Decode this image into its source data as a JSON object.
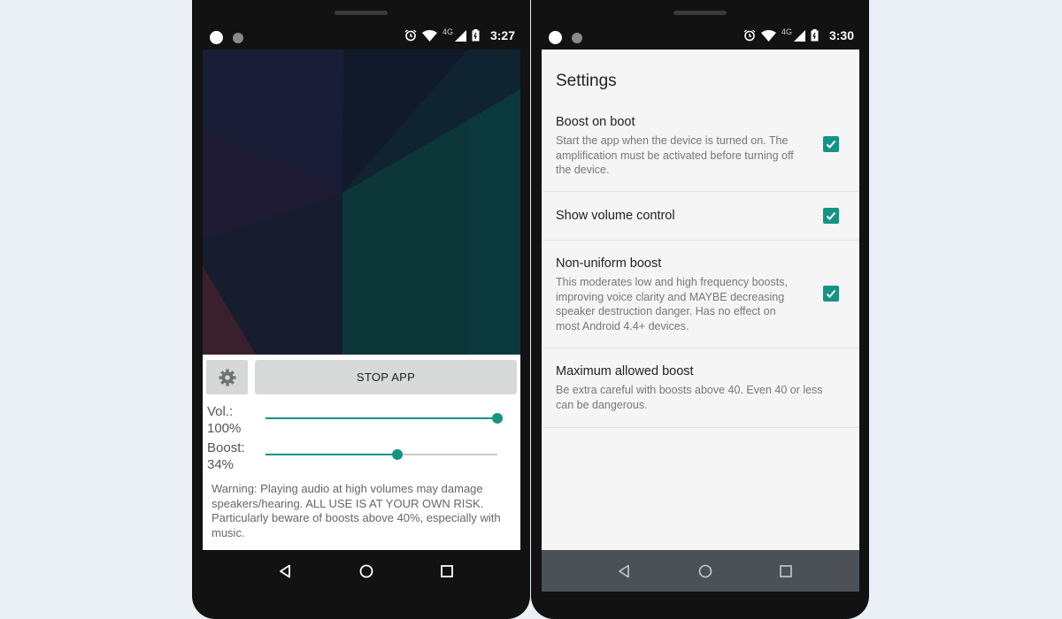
{
  "left_phone": {
    "status": {
      "network": "4G",
      "time": "3:27"
    },
    "controls": {
      "stop_label": "STOP APP",
      "volume_label": "Vol.:",
      "volume_value": "100%",
      "volume_level": 1.0,
      "boost_label": "Boost:",
      "boost_value": "34%",
      "boost_level": 0.57
    },
    "warning": "Warning: Playing audio at high volumes may damage speakers/hearing. ALL USE IS AT YOUR OWN RISK. Particularly beware of boosts above 40%, especially with music."
  },
  "right_phone": {
    "status": {
      "network": "4G",
      "time": "3:30"
    },
    "title": "Settings",
    "prefs": [
      {
        "title": "Boost on boot",
        "summary": "Start the app when the device is turned on. The amplification must be activated before turning off the device.",
        "checked": true
      },
      {
        "title": "Show volume control",
        "summary": "",
        "checked": true
      },
      {
        "title": "Non-uniform boost",
        "summary": "This moderates low and high frequency boosts, improving voice clarity and MAYBE decreasing speaker destruction danger. Has no effect on most Android 4.4+ devices.",
        "checked": true
      },
      {
        "title": "Maximum allowed boost",
        "summary": "Be extra careful with boosts above 40. Even 40 or less can be dangerous.",
        "checked": false
      }
    ]
  },
  "colors": {
    "accent": "#149486",
    "page_bg": "#eaf0f6",
    "phone_body": "#121212",
    "button_gray": "#d7dad9"
  },
  "icons": [
    "alarm-icon",
    "wifi-icon",
    "signal-icon",
    "battery-icon",
    "gear-icon",
    "checkbox-checked-icon",
    "back-icon",
    "home-icon",
    "recents-icon"
  ]
}
